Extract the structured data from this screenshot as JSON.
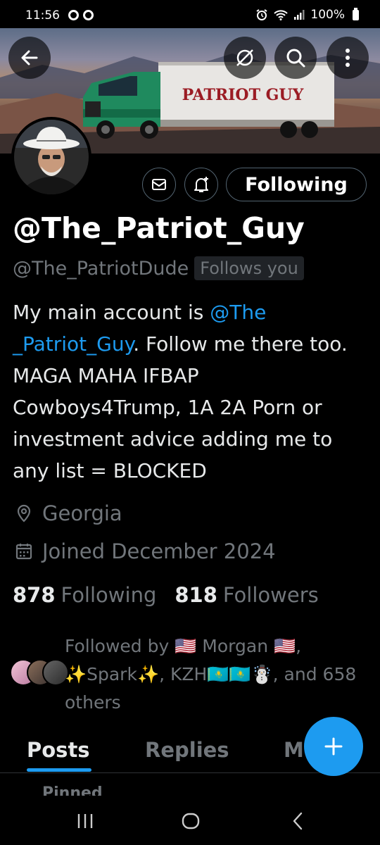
{
  "status_bar": {
    "time": "11:56",
    "battery": "100%"
  },
  "profile": {
    "display_name": "@The_Patriot_Guy",
    "handle": "@The_PatriotDude",
    "follows_you_badge": "Follows you",
    "bio_prefix": "My main account is ",
    "bio_mention": "@The _Patriot_Guy",
    "bio_suffix": ". Follow me there too. MAGA MAHA  IFBAP Cowboys4Trump, 1A 2A Porn or investment advice adding me to any list = BLOCKED",
    "location": "Georgia",
    "joined": "Joined December 2024",
    "following_count": "878",
    "following_label": "Following",
    "followers_count": "818",
    "followers_label": "Followers",
    "followed_by": "Followed by 🇺🇸 Morgan 🇺🇸, ✨Spark✨, KZH🇰🇿🇰🇿☃️, and 658 others"
  },
  "banner": {
    "truck_text": "PATRIOT GUY"
  },
  "buttons": {
    "following": "Following"
  },
  "tabs": [
    "Posts",
    "Replies",
    "M"
  ],
  "pinned_label": "Pinned",
  "colors": {
    "accent": "#1d9bf0",
    "muted": "#71767b",
    "text": "#e7e9ea",
    "background": "#000000"
  },
  "icons": [
    "back-arrow-icon",
    "no-notifications-icon",
    "search-icon",
    "more-vertical-icon",
    "mail-icon",
    "bell-plus-icon",
    "location-pin-icon",
    "calendar-icon",
    "plus-icon",
    "recents-icon",
    "home-icon",
    "back-icon"
  ]
}
